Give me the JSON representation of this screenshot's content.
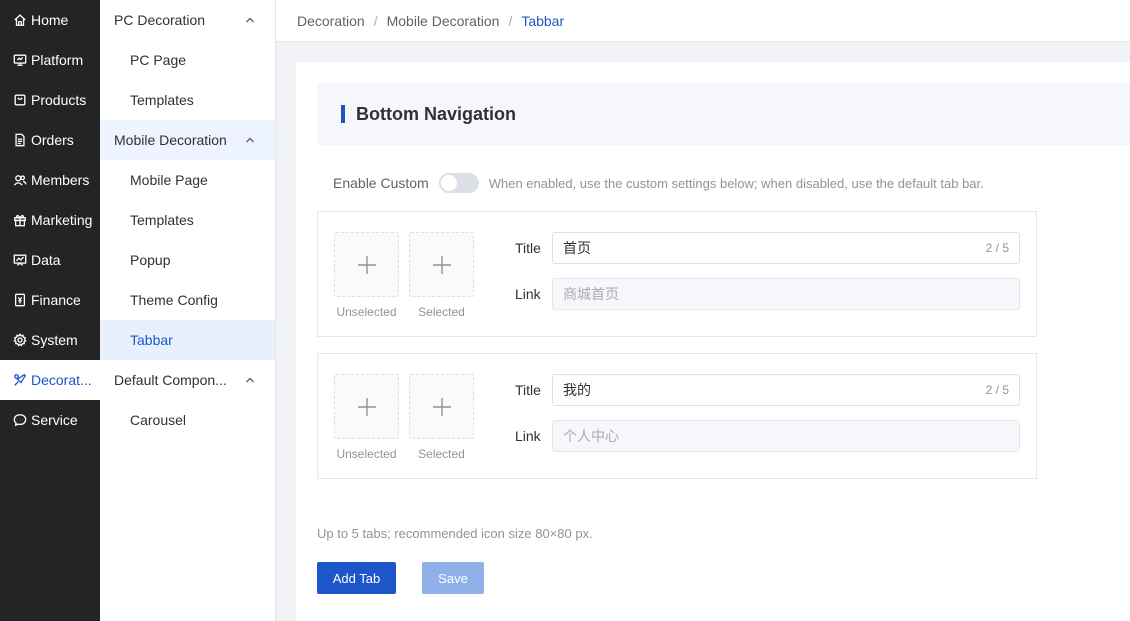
{
  "nav": {
    "items": [
      {
        "label": "Home",
        "icon": "home-icon"
      },
      {
        "label": "Platform",
        "icon": "monitor-icon"
      },
      {
        "label": "Products",
        "icon": "shopping-bag-icon"
      },
      {
        "label": "Orders",
        "icon": "document-icon"
      },
      {
        "label": "Members",
        "icon": "users-icon"
      },
      {
        "label": "Marketing",
        "icon": "gift-icon"
      },
      {
        "label": "Data",
        "icon": "chart-icon"
      },
      {
        "label": "Finance",
        "icon": "ledger-icon"
      },
      {
        "label": "System",
        "icon": "gear-icon"
      },
      {
        "label": "Decorat...",
        "icon": "brush-icon"
      },
      {
        "label": "Service",
        "icon": "chat-icon"
      }
    ],
    "active": "Decorat..."
  },
  "subnav": {
    "group1": {
      "label": "PC Decoration",
      "items": [
        "PC Page",
        "Templates"
      ]
    },
    "group2": {
      "label": "Mobile Decoration",
      "items": [
        "Mobile Page",
        "Templates",
        "Popup",
        "Theme Config",
        "Tabbar"
      ]
    },
    "group3": {
      "label": "Default Compon...",
      "items": [
        "Carousel"
      ]
    },
    "active": "Tabbar"
  },
  "breadcrumb": {
    "items": [
      "Decoration",
      "Mobile Decoration",
      "Tabbar"
    ],
    "separator": "/"
  },
  "section": {
    "title": "Bottom Navigation"
  },
  "enable": {
    "label": "Enable Custom",
    "enabled": false,
    "hint": "When enabled, use the custom settings below; when disabled, use the default tab bar."
  },
  "tabs": [
    {
      "unselected_caption": "Unselected",
      "selected_caption": "Selected",
      "title_label": "Title",
      "title_value": "首页",
      "title_count": "2 / 5",
      "link_label": "Link",
      "link_value": "商城首页"
    },
    {
      "unselected_caption": "Unselected",
      "selected_caption": "Selected",
      "title_label": "Title",
      "title_value": "我的",
      "title_count": "2 / 5",
      "link_label": "Link",
      "link_value": "个人中心"
    }
  ],
  "tip": "Up to 5 tabs; recommended icon size 80×80 px.",
  "buttons": {
    "add": "Add Tab",
    "save": "Save"
  },
  "colors": {
    "accent": "#1d56c9",
    "sidebar_bg": "#242424",
    "disabled_button": "#8fb0e8"
  }
}
